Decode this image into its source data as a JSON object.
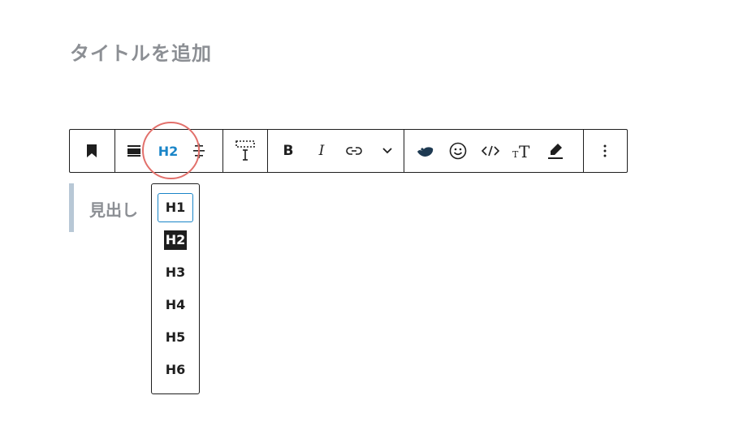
{
  "editor": {
    "title_placeholder": "タイトルを追加",
    "heading_placeholder": "見出し"
  },
  "toolbar": {
    "heading_level_label": "H2",
    "bold_label": "B",
    "italic_label": "I",
    "font_size_label": "TT",
    "icons": [
      "bookmark-icon",
      "align-icon",
      "text-align-icon",
      "spacing-icon",
      "link-icon",
      "chevron-down-icon",
      "bird-icon",
      "emoji-icon",
      "code-icon",
      "font-size-icon",
      "highlighter-icon",
      "more-options-icon"
    ]
  },
  "heading_dropdown": {
    "items": [
      "H1",
      "H2",
      "H3",
      "H4",
      "H5",
      "H6"
    ],
    "selected": "H2",
    "focused": "H1"
  },
  "colors": {
    "accent": "#1a85c8",
    "highlight_circle": "#e2706b",
    "placeholder": "#8c8f94",
    "block_border": "#b8c8d6"
  }
}
